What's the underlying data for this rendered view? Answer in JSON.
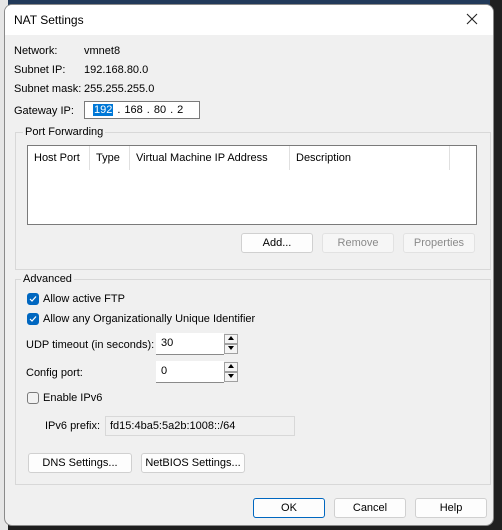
{
  "dialog": {
    "title": "NAT Settings",
    "close_icon": "close-icon"
  },
  "info": {
    "network_label": "Network:",
    "network_value": "vmnet8",
    "subnet_ip_label": "Subnet IP:",
    "subnet_ip_value": "192.168.80.0",
    "subnet_mask_label": "Subnet mask:",
    "subnet_mask_value": "255.255.255.0",
    "gateway_label": "Gateway IP:",
    "gateway_octets": [
      "192",
      "168",
      "80",
      "2"
    ],
    "gateway_selected_octet": "192"
  },
  "port_forwarding": {
    "group_label": "Port Forwarding",
    "columns": [
      "Host Port",
      "Type",
      "Virtual Machine IP Address",
      "Description"
    ],
    "rows": [],
    "add_label": "Add...",
    "remove_label": "Remove",
    "properties_label": "Properties"
  },
  "advanced": {
    "group_label": "Advanced",
    "allow_active_ftp": {
      "label": "Allow active FTP",
      "checked": true
    },
    "allow_oui": {
      "label": "Allow any Organizationally Unique Identifier",
      "checked": true
    },
    "udp_timeout_label": "UDP timeout (in seconds):",
    "udp_timeout_value": "30",
    "config_port_label": "Config port:",
    "config_port_value": "0",
    "enable_ipv6": {
      "label": "Enable IPv6",
      "checked": false
    },
    "ipv6_prefix_label": "IPv6 prefix:",
    "ipv6_prefix_value": "fd15:4ba5:5a2b:1008::/64",
    "dns_settings_label": "DNS Settings...",
    "netbios_settings_label": "NetBIOS Settings..."
  },
  "footer": {
    "ok_label": "OK",
    "cancel_label": "Cancel",
    "help_label": "Help"
  },
  "colors": {
    "accent": "#0067c0",
    "selection": "#0078d7"
  }
}
